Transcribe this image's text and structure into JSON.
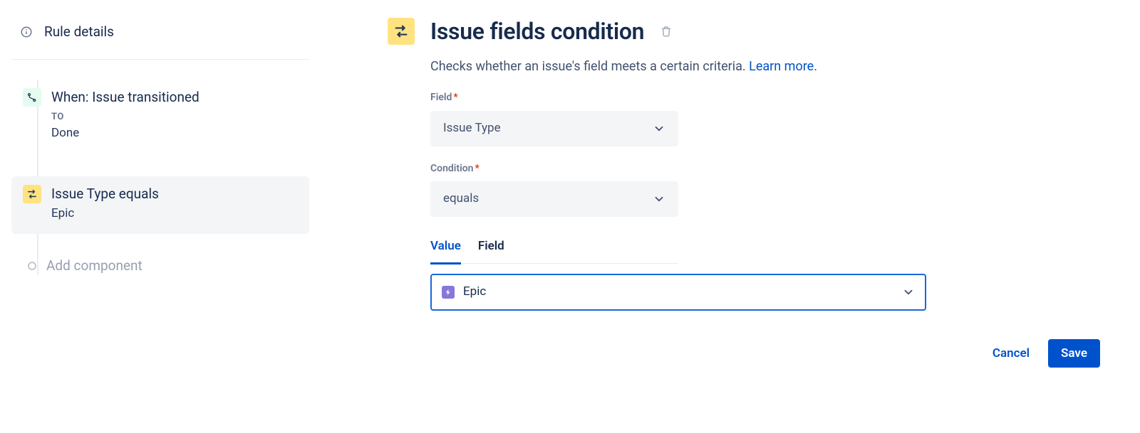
{
  "sidebar": {
    "rule_details": "Rule details",
    "trigger": {
      "title": "When: Issue transitioned",
      "to_label": "TO",
      "to_value": "Done"
    },
    "condition": {
      "title": "Issue Type equals",
      "sub": "Epic"
    },
    "add_component": "Add component"
  },
  "main": {
    "title": "Issue fields condition",
    "description": "Checks whether an issue's field meets a certain criteria.",
    "learn_more": "Learn more.",
    "field_label": "Field",
    "field_value": "Issue Type",
    "condition_label": "Condition",
    "condition_value": "equals",
    "tabs": {
      "value": "Value",
      "field": "Field"
    },
    "value_selected": "Epic",
    "cancel": "Cancel",
    "save": "Save"
  }
}
